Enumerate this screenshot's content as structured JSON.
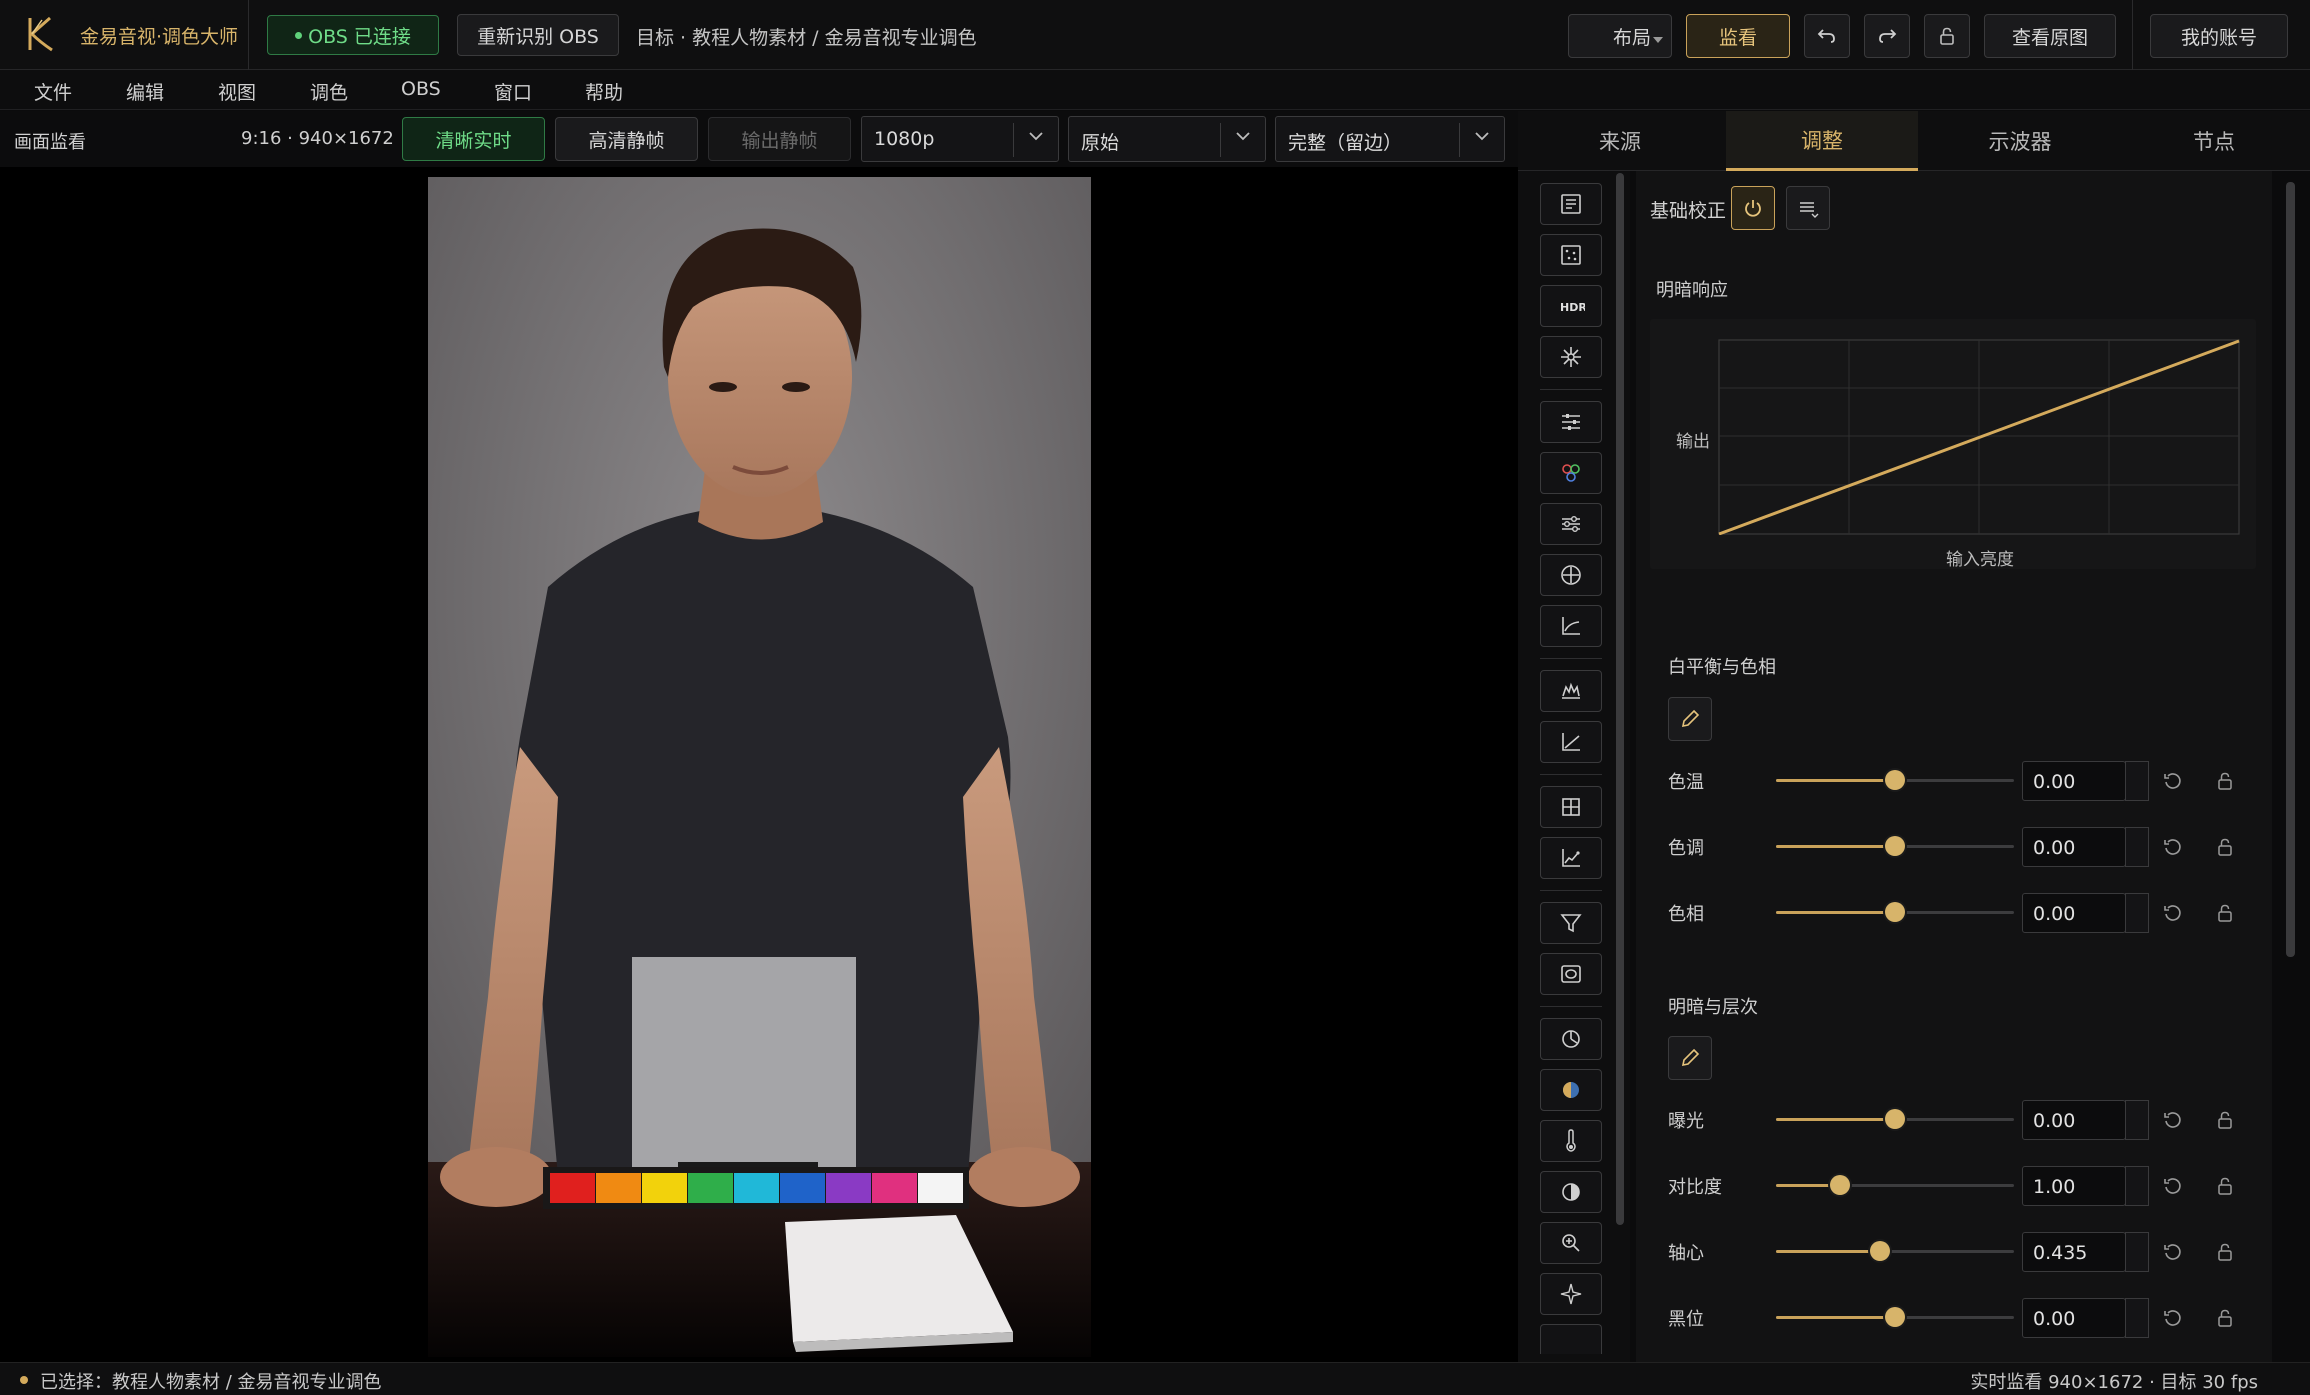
{
  "app": {
    "title": "金易音视·调色大师",
    "logo_color": "#d4aa5c"
  },
  "titlebar": {
    "obs_status": "OBS 已连接",
    "redetect_obs": "重新识别 OBS",
    "target_breadcrumb": "目标 · 教程人物素材 / 金易音视专业调色",
    "layout_label": "布局",
    "monitor_label": "监看",
    "view_original": "查看原图",
    "account": "我的账号"
  },
  "menu": [
    "文件",
    "编辑",
    "视图",
    "调色",
    "OBS",
    "窗口",
    "帮助"
  ],
  "monitor": {
    "title": "画面监看",
    "resolution_info": "9:16 · 940×1672",
    "modes": [
      {
        "label": "清晰实时",
        "active": true
      },
      {
        "label": "高清静帧",
        "active": false
      },
      {
        "label": "输出静帧",
        "active": false
      }
    ],
    "resolution_select": "1080p",
    "source_select": "原始",
    "fit_select": "完整（留边）"
  },
  "tabs": [
    {
      "label": "来源",
      "active": false
    },
    {
      "label": "调整",
      "active": true
    },
    {
      "label": "示波器",
      "active": false
    },
    {
      "label": "节点",
      "active": false
    }
  ],
  "panel": {
    "section_label": "基础校正",
    "curve": {
      "title": "明暗响应",
      "ylabel": "输出",
      "xlabel": "输入亮度"
    },
    "white_balance": {
      "title": "白平衡与色相",
      "controls": [
        {
          "label": "色温",
          "value": "0.00",
          "level": 0.5
        },
        {
          "label": "色调",
          "value": "0.00",
          "level": 0.5
        },
        {
          "label": "色相",
          "value": "0.00",
          "level": 0.5
        }
      ]
    },
    "tone": {
      "title": "明暗与层次",
      "controls": [
        {
          "label": "曝光",
          "value": "0.00",
          "level": 0.5
        },
        {
          "label": "对比度",
          "value": "1.00",
          "level": 0.27
        },
        {
          "label": "轴心",
          "value": "0.435",
          "level": 0.435
        },
        {
          "label": "黑位",
          "value": "0.00",
          "level": 0.5
        }
      ]
    }
  },
  "status": {
    "selected": "已选择：教程人物素材 / 金易音视专业调色",
    "right": "实时监看 940×1672 · 目标 30 fps"
  },
  "colors": {
    "accent": "#d4aa5c",
    "obs_green": "#5fd17a",
    "background": "#0b0b0c"
  }
}
